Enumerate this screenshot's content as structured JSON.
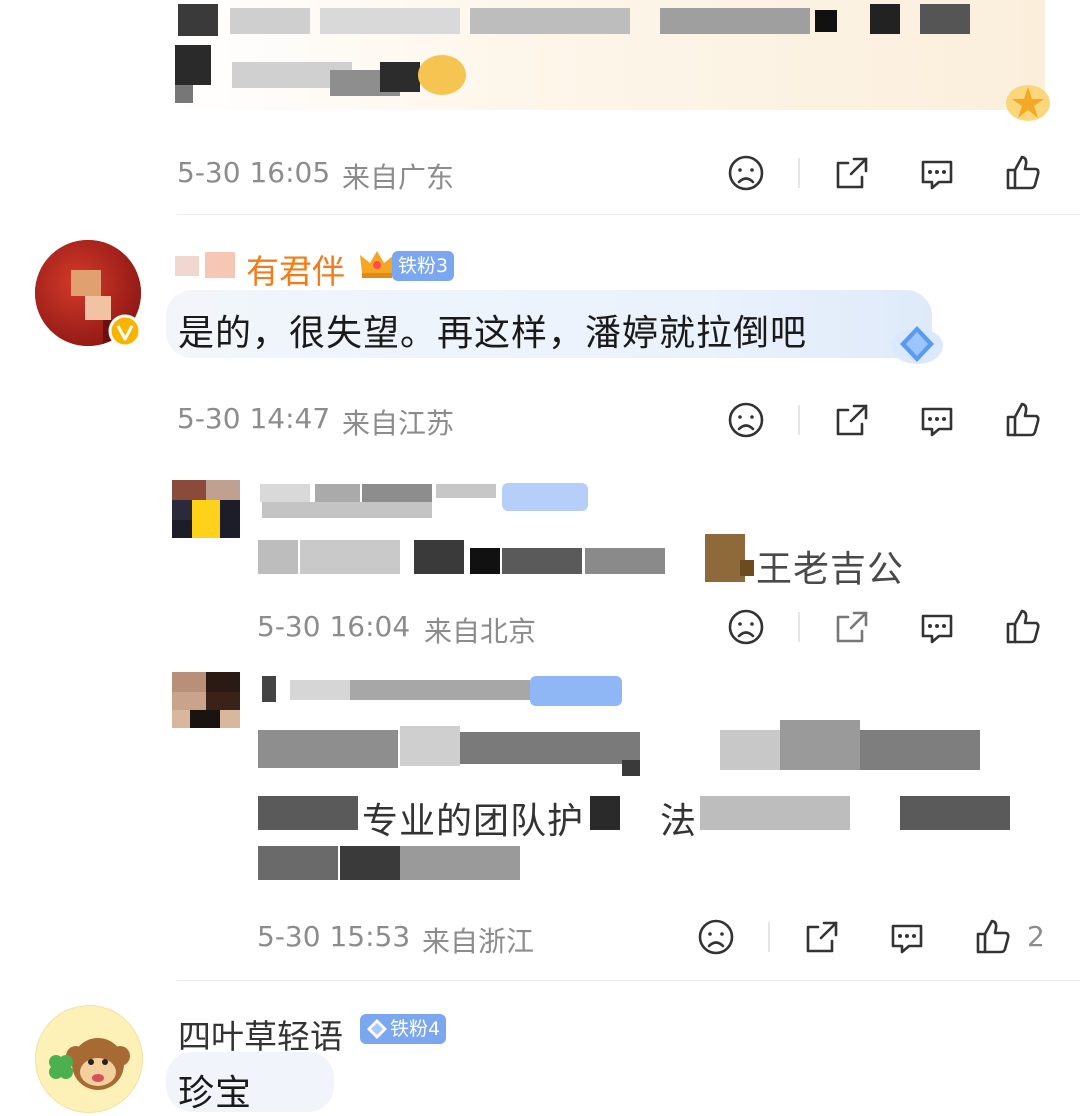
{
  "comments": [
    {
      "timestamp": "5-30 16:05",
      "location": "来自广东"
    },
    {
      "username": "有君伴",
      "fan_badge": "铁粉3",
      "text": "是的，很失望。再这样，潘婷就拉倒吧",
      "timestamp": "5-30 14:47",
      "location": "来自江苏",
      "verified": true
    },
    {
      "text_fragment": "王老吉公",
      "timestamp": "5-30 16:04",
      "location": "来自北京"
    },
    {
      "text_line2_fragment": "专业的团队护",
      "text_line2_fragment_b": "法",
      "timestamp": "5-30 15:53",
      "location": "来自浙江",
      "like_count": "2"
    },
    {
      "username": "四叶草轻语",
      "fan_badge": "铁粉4",
      "text_partial": "珍宝"
    }
  ],
  "icons": {
    "dislike": "frown-face-icon",
    "share": "share-icon",
    "comment": "comment-bubble-icon",
    "like": "thumbs-up-icon"
  },
  "colors": {
    "username_highlight": "#f47c18",
    "meta_text": "#8c8c8c",
    "badge_blue": "#7aa7ef",
    "verified_gold": "#f7b500"
  }
}
